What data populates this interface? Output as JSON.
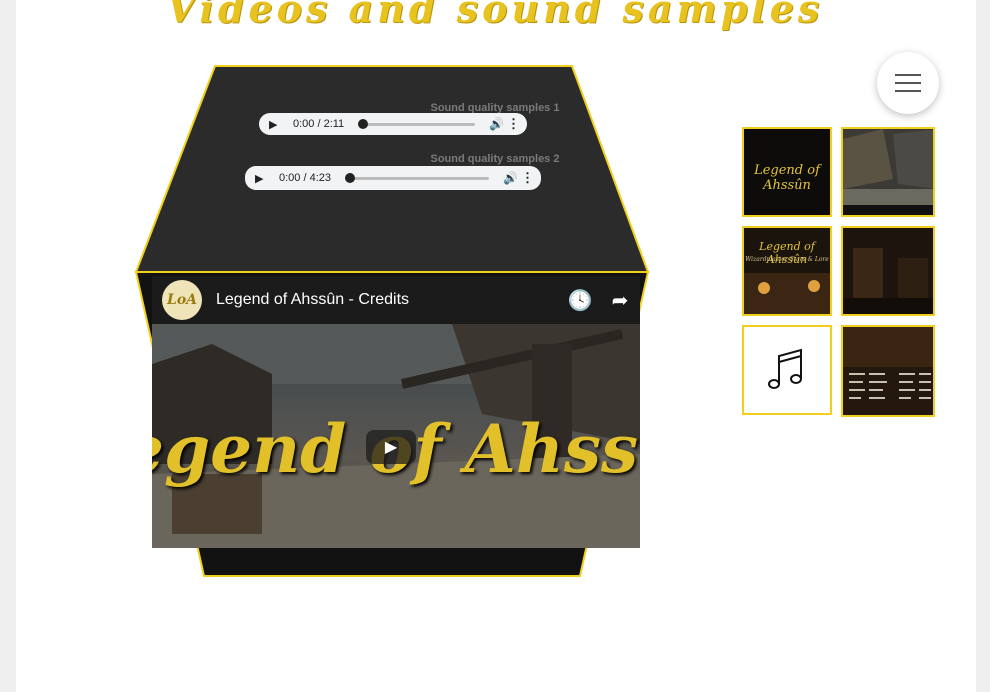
{
  "page": {
    "title": "Videos and sound samples"
  },
  "menu": {
    "icon": "hamburger-menu-icon"
  },
  "audio": [
    {
      "label": "Sound quality samples 1",
      "time": "0:00 / 2:11"
    },
    {
      "label": "Sound quality samples 2",
      "time": "0:00 / 4:23"
    }
  ],
  "video": {
    "title": "Legend of Ahssûn - Credits",
    "channel_avatar_text": "LoA",
    "scene_text": "egend of Ahss",
    "icons": [
      "watch-later-icon",
      "share-icon",
      "play-icon"
    ]
  },
  "gallery": {
    "items": [
      {
        "caption": "Legend of Ahssûn",
        "type": "logo"
      },
      {
        "caption": "",
        "type": "screenshot-street"
      },
      {
        "caption": "Legend of Ahssûn",
        "subcaption": "Wizardmaster Stars & Lore",
        "type": "tavern"
      },
      {
        "caption": "",
        "type": "screenshot-dark-room"
      },
      {
        "caption": "",
        "type": "music-icon"
      },
      {
        "caption": "",
        "type": "credits-screen"
      }
    ]
  },
  "colors": {
    "accent": "#f2cf1d",
    "title": "#e8c21e",
    "cube_dark": "#2b2b2b"
  }
}
